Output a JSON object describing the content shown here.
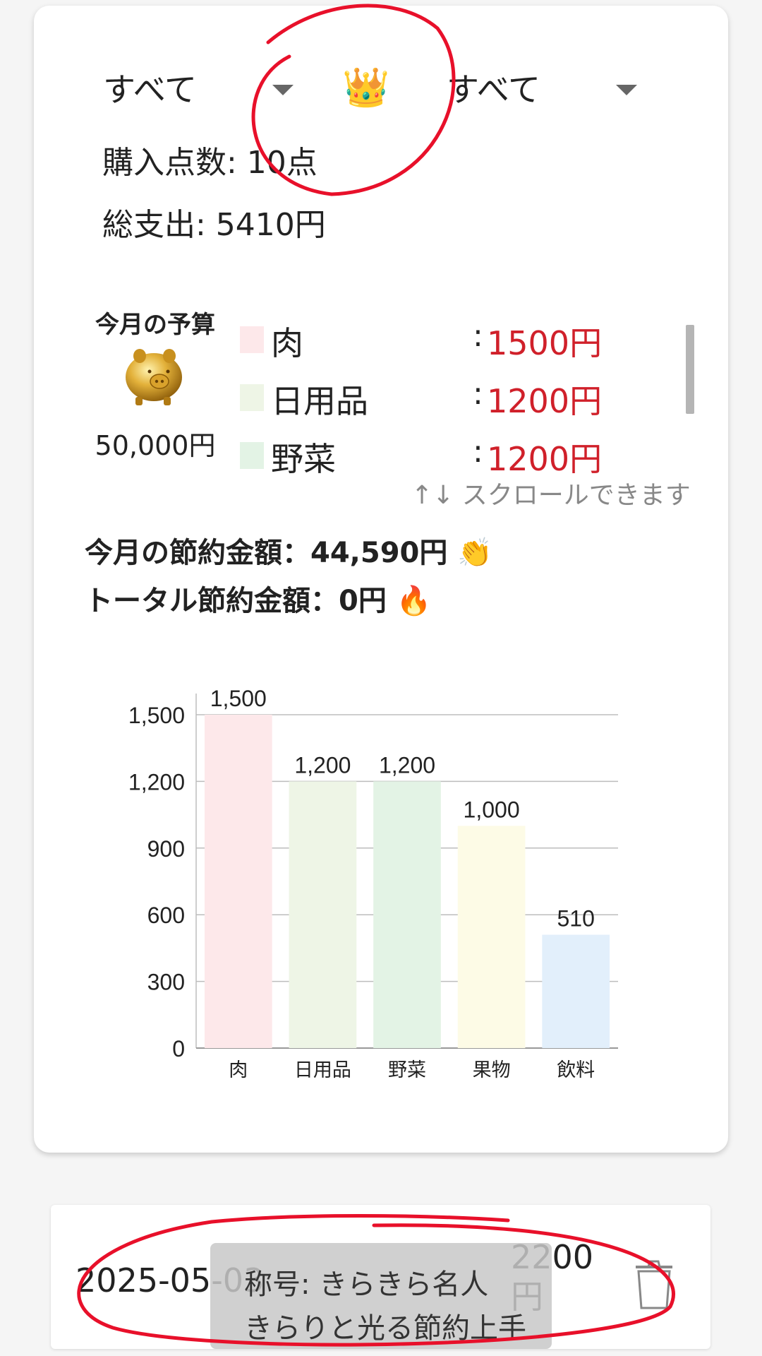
{
  "filters": {
    "left": {
      "label": "すべて",
      "icon": "caret-down-icon"
    },
    "right": {
      "label": "すべて",
      "icon": "caret-down-icon"
    },
    "crown": "👑"
  },
  "stats": {
    "count": "購入点数: 10点",
    "total": "総支出: 5410円"
  },
  "budget": {
    "title": "今月の予算",
    "icon": "piggy-bank-icon",
    "amount": "50,000円",
    "categories": [
      {
        "name": "肉",
        "colon": ":",
        "amount": "1500円",
        "color": "#fde8ea"
      },
      {
        "name": "日用品",
        "colon": ":",
        "amount": "1200円",
        "color": "#eef5e6"
      },
      {
        "name": "野菜",
        "colon": ":",
        "amount": "1200円",
        "color": "#e3f3e5"
      }
    ],
    "scroll_hint": "↑↓ スクロールできます"
  },
  "savings": {
    "month_label": "今月の節約金額：44,590円",
    "month_emoji": "👏",
    "total_label": "トータル節約金額：0円",
    "total_emoji": "🔥"
  },
  "chart_data": {
    "type": "bar",
    "categories": [
      "肉",
      "日用品",
      "野菜",
      "果物",
      "飲料"
    ],
    "values": [
      1500,
      1200,
      1200,
      1000,
      510
    ],
    "data_labels": [
      "1,500",
      "1,200",
      "1,200",
      "1,000",
      "510"
    ],
    "colors": [
      "#fde8ea",
      "#eef5e6",
      "#e3f3e5",
      "#fdfbe6",
      "#e2effb"
    ],
    "ylim": [
      0,
      1500
    ],
    "yticks": [
      0,
      300,
      600,
      900,
      1200,
      1500
    ],
    "ytick_labels": [
      "0",
      "300",
      "600",
      "900",
      "1,200",
      "1,500"
    ],
    "grid": true
  },
  "entry": {
    "date": "2025-05-03",
    "price": "2200円",
    "delete_icon": "trash-icon"
  },
  "toast": {
    "line1": "称号: きらきら名人",
    "line2": "きらりと光る節約上手"
  },
  "annotation_color": "#e8102a"
}
